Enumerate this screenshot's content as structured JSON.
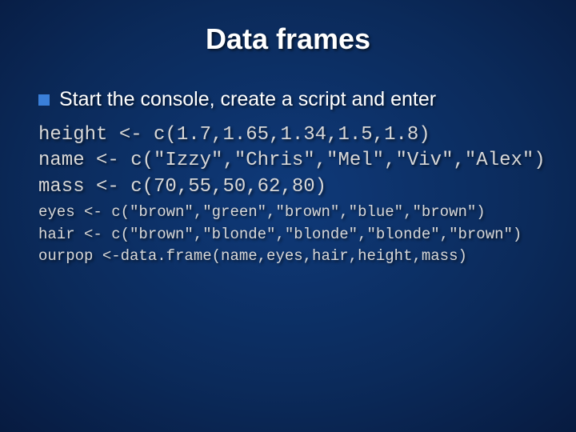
{
  "title": "Data frames",
  "bullet": "Start the console, create a script and enter",
  "code_large": [
    "height <- c(1.7,1.65,1.34,1.5,1.8)",
    "name <- c(\"Izzy\",\"Chris\",\"Mel\",\"Viv\",\"Alex\")",
    "mass <- c(70,55,50,62,80)"
  ],
  "code_small": [
    "eyes <- c(\"brown\",\"green\",\"brown\",\"blue\",\"brown\")",
    "hair <- c(\"brown\",\"blonde\",\"blonde\",\"blonde\",\"brown\")",
    "ourpop <-data.frame(name,eyes,hair,height,mass)"
  ]
}
